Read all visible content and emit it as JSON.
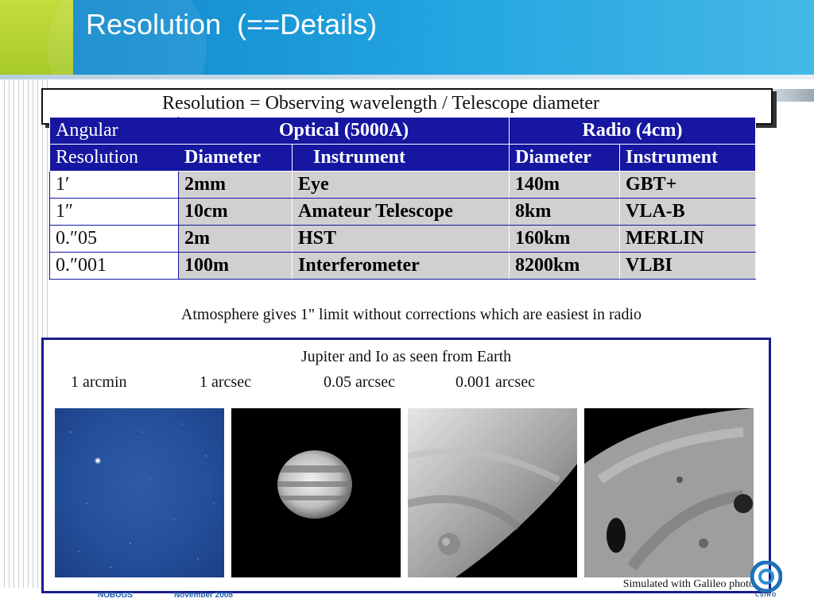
{
  "slide": {
    "title": "Resolution  (==Details)"
  },
  "formula": "Resolution = Observing wavelength / Telescope diameter",
  "table": {
    "header_row1": {
      "col0": "Angular",
      "optical": "Optical  (5000A)",
      "radio": "Radio (4cm)"
    },
    "header_row2": {
      "col0": "Resolution",
      "optical_diameter": "Diameter",
      "optical_instrument": "Instrument",
      "radio_diameter": "Diameter",
      "radio_instrument": "Instrument"
    },
    "rows": [
      {
        "resolution": "1′",
        "optical_diameter": "2mm",
        "optical_instrument": "Eye",
        "radio_diameter": "140m",
        "radio_instrument": "GBT+"
      },
      {
        "resolution": "1″",
        "optical_diameter": "10cm",
        "optical_instrument": "Amateur Telescope",
        "radio_diameter": "8km",
        "radio_instrument": "VLA-B"
      },
      {
        "resolution": "0.″05",
        "optical_diameter": "2m",
        "optical_instrument": "HST",
        "radio_diameter": "160km",
        "radio_instrument": "MERLIN"
      },
      {
        "resolution": "0.″001",
        "optical_diameter": "100m",
        "optical_instrument": "Interferometer",
        "radio_diameter": "8200km",
        "radio_instrument": "VLBI"
      }
    ]
  },
  "atmosphere_note": "Atmosphere gives 1\" limit without corrections which are easiest in radio",
  "image_panel": {
    "caption": "Jupiter and Io as seen from Earth",
    "scales": [
      "1 arcmin",
      "1 arcsec",
      "0.05 arcsec",
      "0.001 arcsec"
    ],
    "simulated_note": "Simulated with Galileo photo"
  },
  "footer": {
    "event": "NOBUGS",
    "date": "November 2008",
    "logo_text": "CSIRO"
  },
  "colors": {
    "header_blue": "#0d82c8",
    "header_green": "#a6c92a",
    "table_header": "#1616a0",
    "table_cell": "#d0d0d0",
    "panel_border": "#1c1c8c"
  }
}
